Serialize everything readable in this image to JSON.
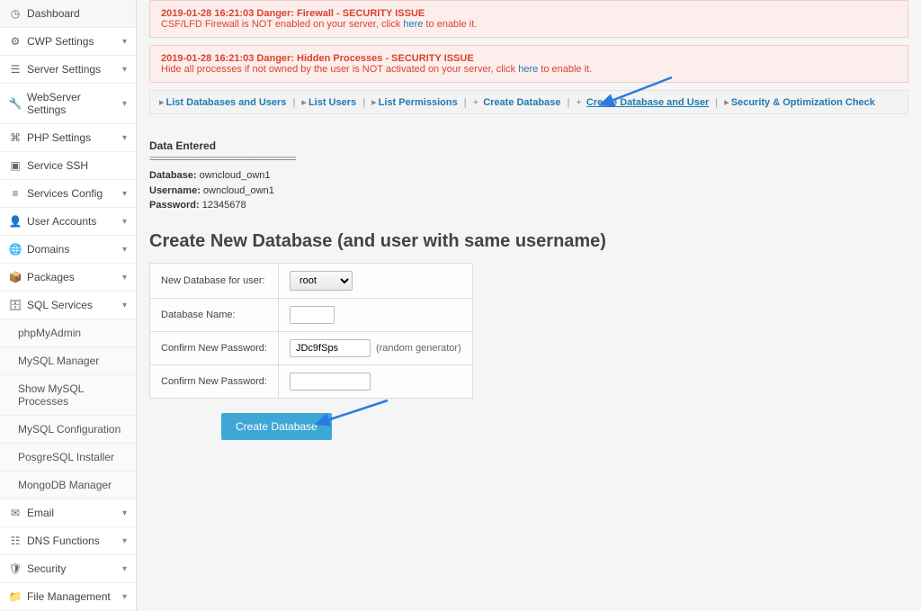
{
  "sidebar": {
    "items": [
      {
        "label": "Dashboard",
        "icon": "speedometer"
      },
      {
        "label": "CWP Settings",
        "icon": "gears"
      },
      {
        "label": "Server Settings",
        "icon": "server"
      },
      {
        "label": "WebServer Settings",
        "icon": "wrench"
      },
      {
        "label": "PHP Settings",
        "icon": "php"
      },
      {
        "label": "Service SSH",
        "icon": "terminal"
      },
      {
        "label": "Services Config",
        "icon": "list"
      },
      {
        "label": "User Accounts",
        "icon": "user"
      },
      {
        "label": "Domains",
        "icon": "globe"
      },
      {
        "label": "Packages",
        "icon": "package"
      },
      {
        "label": "SQL Services",
        "icon": "database"
      }
    ],
    "sql_sub": [
      {
        "label": "phpMyAdmin"
      },
      {
        "label": "MySQL Manager"
      },
      {
        "label": "Show MySQL Processes"
      },
      {
        "label": "MySQL Configuration"
      },
      {
        "label": "PosgreSQL Installer"
      },
      {
        "label": "MongoDB Manager"
      }
    ],
    "items_after": [
      {
        "label": "Email",
        "icon": "envelope"
      },
      {
        "label": "DNS Functions",
        "icon": "dns"
      },
      {
        "label": "Security",
        "icon": "shield"
      },
      {
        "label": "File Management",
        "icon": "folder"
      }
    ]
  },
  "alerts": [
    {
      "title": "2019-01-28 16:21:03 Danger: Firewall - SECURITY ISSUE",
      "msg_pre": "CSF/LFD Firewall is NOT enabled on your server, click ",
      "link": "here",
      "msg_post": " to enable it."
    },
    {
      "title": "2019-01-28 16:21:03 Danger: Hidden Processes - SECURITY ISSUE",
      "msg_pre": "Hide all processes if not owned by the user is NOT activated on your server, click ",
      "link": "here",
      "msg_post": " to enable it."
    }
  ],
  "breadcrumbs": {
    "items": [
      {
        "label": "List Databases and Users",
        "prefix": "▸"
      },
      {
        "label": "List Users",
        "prefix": "▸"
      },
      {
        "label": "List Permissions",
        "prefix": "▸"
      },
      {
        "label": "Create Database",
        "prefix": "+"
      },
      {
        "label": "Create Database and User",
        "prefix": "+",
        "underline": true
      },
      {
        "label": "Security & Optimization Check",
        "prefix": "▸"
      }
    ]
  },
  "data_entered": {
    "heading": "Data Entered",
    "divider": "==============================",
    "database_label": "Database:",
    "database_value": "owncloud_own1",
    "username_label": "Username:",
    "username_value": "owncloud_own1",
    "password_label": "Password:",
    "password_value": "12345678"
  },
  "section_title": "Create New Database (and user with same username)",
  "form": {
    "user_label": "New Database for user:",
    "user_value": "root",
    "dbname_label": "Database Name:",
    "dbname_value": "",
    "pass_label": "Confirm New Password:",
    "pass_value": "JDc9fSps",
    "pass_hint": "(random generator)",
    "pass2_label": "Confirm New Password:",
    "pass2_value": "",
    "submit_label": "Create Database"
  }
}
